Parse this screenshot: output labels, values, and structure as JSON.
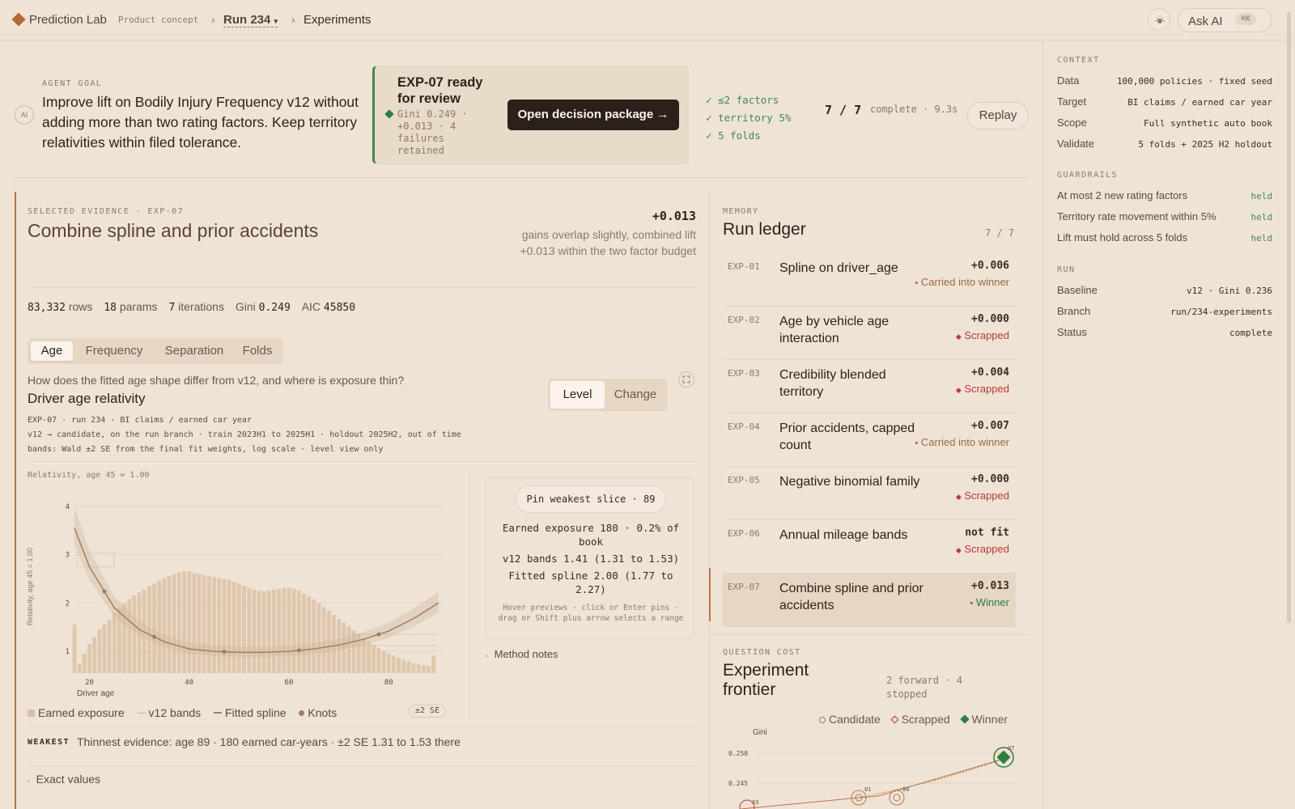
{
  "topbar": {
    "app_name": "Prediction Lab",
    "app_tag": "Product concept",
    "run_label": "Run 234",
    "run_caret": "▾",
    "sep": "›",
    "page": "Experiments",
    "ask_ai": "Ask AI",
    "shortcut": "⌘K"
  },
  "goal": {
    "label": "AGENT GOAL",
    "ai_badge": "AI",
    "text": "Improve lift on Bodily Injury Frequency v12 without adding more than two rating factors. Keep territory relativities within filed tolerance."
  },
  "review": {
    "title": "EXP-07 ready for review",
    "meta": "Gini 0.249 · +0.013 · 4 failures retained",
    "button": "Open decision package →",
    "checks": [
      "≤2 factors",
      "territory 5%",
      "5 folds"
    ],
    "progress": "7 / 7",
    "progress_meta": "complete · 9.3s",
    "replay": "Replay"
  },
  "evidence": {
    "label": "SELECTED EVIDENCE · EXP-07",
    "title": "Combine spline and prior accidents",
    "delta": "+0.013",
    "note": "gains overlap slightly, combined lift +0.013 within the two factor budget",
    "stats": [
      {
        "num": "83,332",
        "unit": "rows"
      },
      {
        "num": "18",
        "unit": "params"
      },
      {
        "num": "7",
        "unit": "iterations"
      },
      {
        "unit": "Gini",
        "num": "0.249"
      },
      {
        "unit": "AIC",
        "num": "45850"
      }
    ],
    "tabs": [
      "Age",
      "Frequency",
      "Separation",
      "Folds"
    ],
    "question": "How does the fitted age shape differ from v12, and where is exposure thin?",
    "chart_title": "Driver age relativity",
    "toggle": [
      "Level",
      "Change"
    ],
    "meta1": "EXP-07 · run 234 · BI claims / earned car year",
    "meta2": "v12 → candidate, on the run branch · train 2023H1 to 2025H1 · holdout 2025H2, out of time",
    "meta3": "bands: Wald ±2 SE from the final fit weights, log scale · level view only",
    "legend": [
      "Earned exposure",
      "v12 bands",
      "Fitted spline",
      "Knots"
    ],
    "se_badge": "±2 SE",
    "weakest_label": "WEAKEST",
    "weakest_text": "Thinnest evidence: age 89 · 180 earned car-years · ±2 SE 1.31 to 1.53 there",
    "exact_values": "Exact values"
  },
  "callout": {
    "pin": "Pin weakest slice · 89",
    "l1": "Earned exposure 180 · 0.2% of book",
    "l2": "v12 bands 1.41 (1.31 to 1.53)",
    "l3": "Fitted spline 2.00 (1.77 to 2.27)",
    "hint": "Hover previews · click or Enter pins · drag or Shift plus arrow selects a range",
    "method": "Method notes"
  },
  "chart_data": [
    {
      "type": "bar",
      "title": "Driver age relativity",
      "ylabel": "Relativity, age 45 = 1.00",
      "xlabel": "Driver age",
      "x_ticks": [
        20,
        40,
        60,
        80
      ],
      "y_ticks": [
        1,
        2,
        3,
        4
      ],
      "xlim": [
        17,
        91
      ],
      "ylim": [
        0.55,
        4.2
      ],
      "series": [
        {
          "name": "Fitted spline",
          "type": "line",
          "x": [
            17,
            20,
            25,
            30,
            35,
            40,
            45,
            50,
            55,
            60,
            65,
            70,
            75,
            80,
            85,
            90
          ],
          "y": [
            3.55,
            2.75,
            1.9,
            1.45,
            1.2,
            1.05,
            1.0,
            0.98,
            0.98,
            1.0,
            1.05,
            1.13,
            1.25,
            1.42,
            1.68,
            2.0
          ]
        },
        {
          "name": "Earned exposure",
          "type": "bar",
          "x": [
            17,
            18,
            19,
            20,
            21,
            22,
            23,
            24,
            25,
            26,
            27,
            28,
            29,
            30,
            31,
            32,
            33,
            34,
            35,
            36,
            37,
            38,
            39,
            40,
            41,
            42,
            43,
            44,
            45,
            46,
            47,
            48,
            49,
            50,
            51,
            52,
            53,
            54,
            55,
            56,
            57,
            58,
            59,
            60,
            61,
            62,
            63,
            64,
            65,
            66,
            67,
            68,
            69,
            70,
            71,
            72,
            73,
            74,
            75,
            76,
            77,
            78,
            79,
            80,
            81,
            82,
            83,
            84,
            85,
            86,
            87,
            88,
            89
          ],
          "y": [
            0.5,
            0.1,
            0.2,
            0.3,
            0.37,
            0.45,
            0.5,
            0.55,
            0.62,
            0.68,
            0.72,
            0.76,
            0.8,
            0.83,
            0.86,
            0.9,
            0.92,
            0.95,
            0.98,
            1.0,
            1.02,
            1.04,
            1.05,
            1.05,
            1.03,
            1.02,
            1.01,
            1.0,
            0.99,
            0.98,
            0.97,
            0.96,
            0.94,
            0.92,
            0.9,
            0.88,
            0.86,
            0.85,
            0.84,
            0.85,
            0.86,
            0.87,
            0.88,
            0.88,
            0.87,
            0.85,
            0.82,
            0.79,
            0.76,
            0.72,
            0.68,
            0.64,
            0.6,
            0.56,
            0.52,
            0.48,
            0.44,
            0.4,
            0.36,
            0.32,
            0.29,
            0.26,
            0.23,
            0.2,
            0.18,
            0.16,
            0.14,
            0.12,
            0.1,
            0.09,
            0.08,
            0.07,
            0.18
          ]
        }
      ],
      "knots": [
        23,
        33,
        47,
        62,
        78
      ],
      "legend": "bottom"
    },
    {
      "type": "scatter",
      "title": "Experiment frontier",
      "ylabel": "Gini",
      "y_ticks": [
        0.25,
        0.245
      ],
      "series": [
        {
          "name": "Candidate",
          "points": [
            {
              "label": "01",
              "y": 0.242
            },
            {
              "label": "04",
              "y": 0.242
            }
          ]
        },
        {
          "name": "Scrapped",
          "points": [
            {
              "label": "03",
              "y": 0.24
            }
          ]
        },
        {
          "name": "Winner",
          "points": [
            {
              "label": "07",
              "y": 0.249
            }
          ]
        }
      ]
    }
  ],
  "ledger": {
    "label": "MEMORY",
    "title": "Run ledger",
    "count": "7 / 7",
    "rows": [
      {
        "id": "EXP-01",
        "name": "Spline on driver_age",
        "delta": "+0.006",
        "status": "Carried into winner",
        "kind": "carried"
      },
      {
        "id": "EXP-02",
        "name": "Age by vehicle age interaction",
        "delta": "+0.000",
        "status": "Scrapped",
        "kind": "scrapped"
      },
      {
        "id": "EXP-03",
        "name": "Credibility blended territory",
        "delta": "+0.004",
        "status": "Scrapped",
        "kind": "scrapped"
      },
      {
        "id": "EXP-04",
        "name": "Prior accidents, capped count",
        "delta": "+0.007",
        "status": "Carried into winner",
        "kind": "carried"
      },
      {
        "id": "EXP-05",
        "name": "Negative binomial family",
        "delta": "+0.000",
        "status": "Scrapped",
        "kind": "scrapped"
      },
      {
        "id": "EXP-06",
        "name": "Annual mileage bands",
        "delta": "not fit",
        "status": "Scrapped",
        "kind": "scrapped"
      },
      {
        "id": "EXP-07",
        "name": "Combine spline and prior accidents",
        "delta": "+0.013",
        "status": "Winner",
        "kind": "winner"
      }
    ]
  },
  "frontier": {
    "label": "QUESTION COST",
    "title": "Experiment frontier",
    "meta": "2 forward · 4 stopped",
    "legend": [
      "Candidate",
      "Scrapped",
      "Winner"
    ],
    "y_label": "Gini",
    "ticks": [
      "0.250",
      "0.245"
    ],
    "point_labels": [
      "07",
      "01",
      "04",
      "03"
    ]
  },
  "context": {
    "label": "CONTEXT",
    "rows": [
      {
        "k": "Data",
        "v": "100,000 policies · fixed seed"
      },
      {
        "k": "Target",
        "v": "BI claims / earned car year"
      },
      {
        "k": "Scope",
        "v": "Full synthetic auto book"
      },
      {
        "k": "Validate",
        "v": "5 folds + 2025 H2 holdout"
      }
    ],
    "guard_label": "GUARDRAILS",
    "guards": [
      {
        "k": "At most 2 new rating factors",
        "v": "held"
      },
      {
        "k": "Territory rate movement within 5%",
        "v": "held"
      },
      {
        "k": "Lift must hold across 5 folds",
        "v": "held"
      }
    ],
    "run_label": "RUN",
    "run": [
      {
        "k": "Baseline",
        "v": "v12 · Gini 0.236"
      },
      {
        "k": "Branch",
        "v": "run/234-experiments"
      },
      {
        "k": "Status",
        "v": "complete"
      }
    ]
  },
  "colors": {
    "accent": "#b06a3c",
    "winner": "#2f7d40",
    "scrapped": "#b83a36",
    "bg": "#efe3d5"
  }
}
